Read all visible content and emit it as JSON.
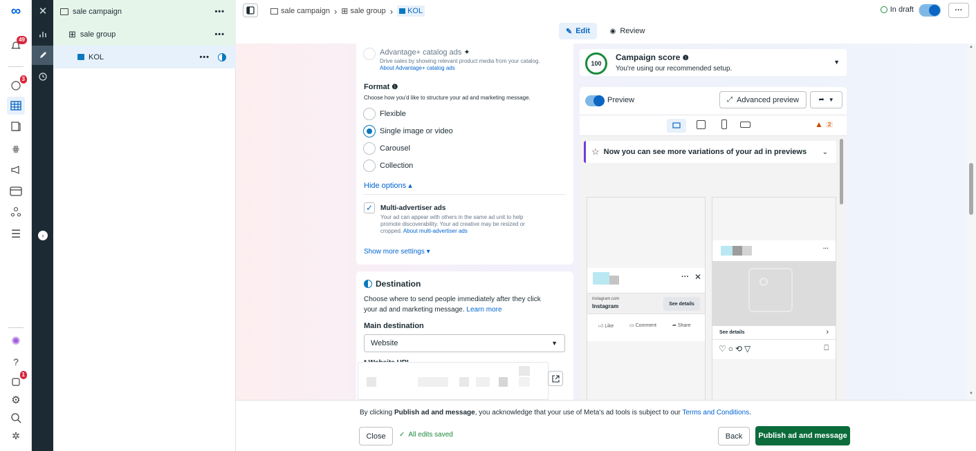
{
  "rail": {
    "badges": {
      "notifications": "49",
      "messages": "3",
      "help": "1"
    }
  },
  "tree": {
    "campaign": "sale campaign",
    "adset": "sale group",
    "ad": "KOL",
    "more": "•••"
  },
  "breadcrumb": {
    "campaign": "sale campaign",
    "adset": "sale group",
    "ad": "KOL",
    "sep": "›"
  },
  "topbar": {
    "status": "In draft",
    "more": "···"
  },
  "modes": {
    "edit": "Edit",
    "review": "Review"
  },
  "form": {
    "catalog_title": "Advantage+ catalog ads",
    "catalog_desc": "Drive sales by showing relevant product media from your catalog.",
    "catalog_link": "About Advantage+ catalog ads",
    "format_title": "Format",
    "format_desc": "Choose how you'd like to structure your ad and marketing message.",
    "format_options": [
      "Flexible",
      "Single image or video",
      "Carousel",
      "Collection"
    ],
    "hide_options": "Hide options ▴",
    "multi_title": "Multi-advertiser ads",
    "multi_desc_1": "Your ad can appear with others in the same ad unit to help",
    "multi_desc_2": "promote discoverability. Your ad creative may be resized or",
    "multi_desc_3": "cropped.",
    "multi_link": "About multi-advertiser ads",
    "show_more": "Show more settings ▾",
    "dest_title": "Destination",
    "dest_desc_1": "Choose where to send people immediately after they click",
    "dest_desc_2": "your ad and marketing message.",
    "dest_link": "Learn more",
    "main_dest_label": "Main destination",
    "main_dest_value": "Website",
    "url_label": "* Website URL"
  },
  "score": {
    "value": "100",
    "title": "Campaign score",
    "desc": "You're using our recommended setup."
  },
  "preview": {
    "label": "Preview",
    "advanced": "Advanced preview",
    "warning_count": "2",
    "banner": "Now you can see more variations of your ad in previews",
    "ig_domain": "instagram.com",
    "ig_name": "Instagram",
    "see_details_btn": "See details",
    "like": "Like",
    "comment": "Comment",
    "share": "Share",
    "see_details_row": "See details"
  },
  "footer": {
    "notice_pre": "By clicking ",
    "notice_bold": "Publish ad and message",
    "notice_mid": ", you acknowledge that your use of Meta's ad tools is subject to our ",
    "notice_link": "Terms and Conditions",
    "notice_end": ".",
    "close": "Close",
    "saved": "All edits saved",
    "back": "Back",
    "publish": "Publish ad and message"
  }
}
